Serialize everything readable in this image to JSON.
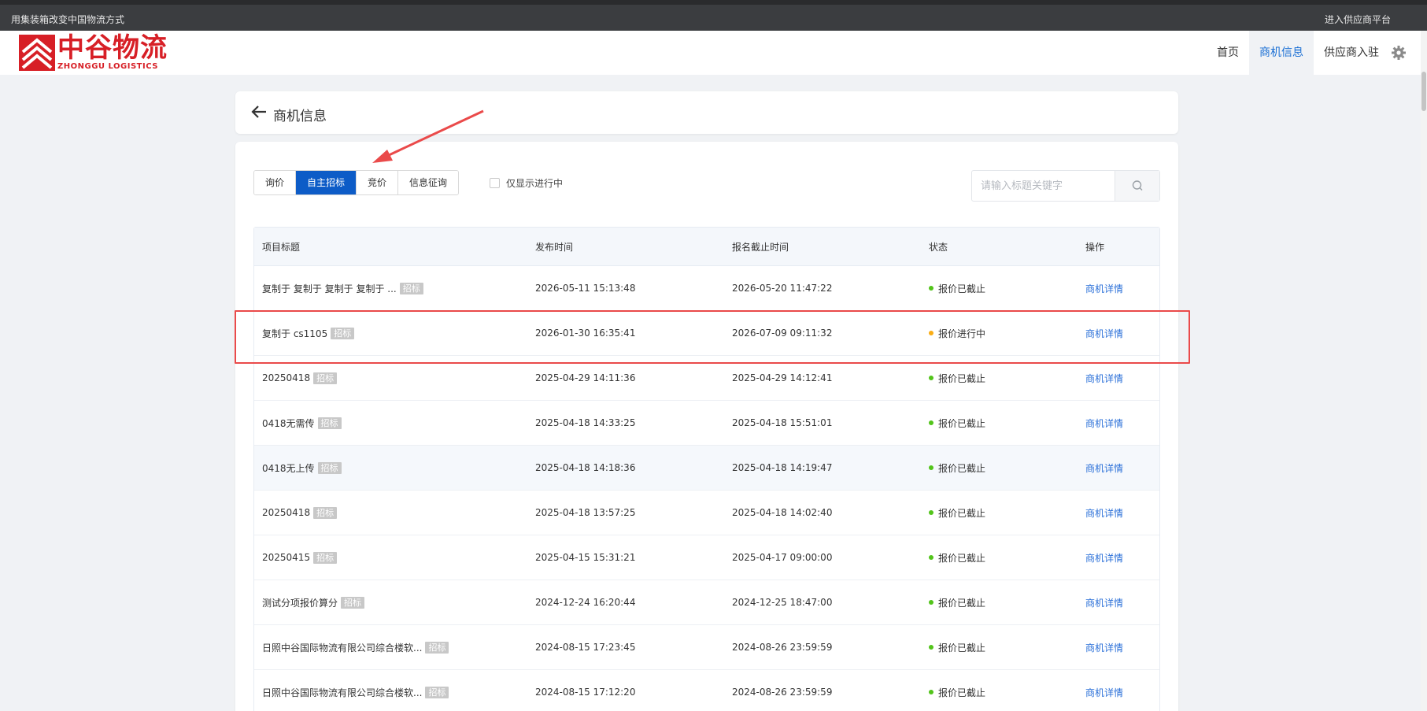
{
  "topbar": {
    "slogan": "用集装箱改变中国物流方式",
    "supplier_platform": "进入供应商平台"
  },
  "brand": {
    "name_cn": "中谷物流",
    "name_en": "ZHONGGU LOGISTICS",
    "color": "#d71f26"
  },
  "nav": {
    "items": [
      {
        "label": "首页",
        "active": false
      },
      {
        "label": "商机信息",
        "active": true
      },
      {
        "label": "供应商入驻",
        "active": false
      }
    ],
    "settings_icon": "gear-icon"
  },
  "page": {
    "title": "商机信息"
  },
  "tabs": [
    {
      "label": "询价",
      "active": false
    },
    {
      "label": "自主招标",
      "active": true
    },
    {
      "label": "竞价",
      "active": false
    },
    {
      "label": "信息征询",
      "active": false
    }
  ],
  "filter": {
    "only_active_label": "仅显示进行中",
    "checked": false
  },
  "search": {
    "placeholder": "请输入标题关键字",
    "value": ""
  },
  "table": {
    "columns": [
      "项目标题",
      "发布时间",
      "报名截止时间",
      "状态",
      "操作"
    ],
    "rows": [
      {
        "title": "复制于 复制于 复制于 复制于 ...",
        "tag": "招标",
        "publish": "2026-05-11 15:13:48",
        "deadline": "2026-05-20 11:47:22",
        "status": "报价已截止",
        "status_color": "#52c41a",
        "action": "商机详情"
      },
      {
        "title": "复制于 cs1105",
        "tag": "招标",
        "publish": "2026-01-30 16:35:41",
        "deadline": "2026-07-09 09:11:32",
        "status": "报价进行中",
        "status_color": "#faad14",
        "action": "商机详情"
      },
      {
        "title": "20250418",
        "tag": "招标",
        "publish": "2025-04-29 14:11:36",
        "deadline": "2025-04-29 14:12:41",
        "status": "报价已截止",
        "status_color": "#52c41a",
        "action": "商机详情"
      },
      {
        "title": "0418无需传",
        "tag": "招标",
        "publish": "2025-04-18 14:33:25",
        "deadline": "2025-04-18 15:51:01",
        "status": "报价已截止",
        "status_color": "#52c41a",
        "action": "商机详情"
      },
      {
        "title": "0418无上传",
        "tag": "招标",
        "publish": "2025-04-18 14:18:36",
        "deadline": "2025-04-18 14:19:47",
        "status": "报价已截止",
        "status_color": "#52c41a",
        "action": "商机详情"
      },
      {
        "title": "20250418",
        "tag": "招标",
        "publish": "2025-04-18 13:57:25",
        "deadline": "2025-04-18 14:02:40",
        "status": "报价已截止",
        "status_color": "#52c41a",
        "action": "商机详情"
      },
      {
        "title": "20250415",
        "tag": "招标",
        "publish": "2025-04-15 15:31:21",
        "deadline": "2025-04-17 09:00:00",
        "status": "报价已截止",
        "status_color": "#52c41a",
        "action": "商机详情"
      },
      {
        "title": "测试分项报价算分",
        "tag": "招标",
        "publish": "2024-12-24 16:20:44",
        "deadline": "2024-12-25 18:47:00",
        "status": "报价已截止",
        "status_color": "#52c41a",
        "action": "商机详情"
      },
      {
        "title": "日照中谷国际物流有限公司综合楼软...",
        "tag": "招标",
        "publish": "2024-08-15 17:23:45",
        "deadline": "2024-08-26 23:59:59",
        "status": "报价已截止",
        "status_color": "#52c41a",
        "action": "商机详情"
      },
      {
        "title": "日照中谷国际物流有限公司综合楼软...",
        "tag": "招标",
        "publish": "2024-08-15 17:12:20",
        "deadline": "2024-08-26 23:59:59",
        "status": "报价已截止",
        "status_color": "#52c41a",
        "action": "商机详情"
      }
    ]
  },
  "colors": {
    "primary": "#0d5cc7",
    "link": "#2a6fd8",
    "annotation": "#ea4a4a"
  }
}
